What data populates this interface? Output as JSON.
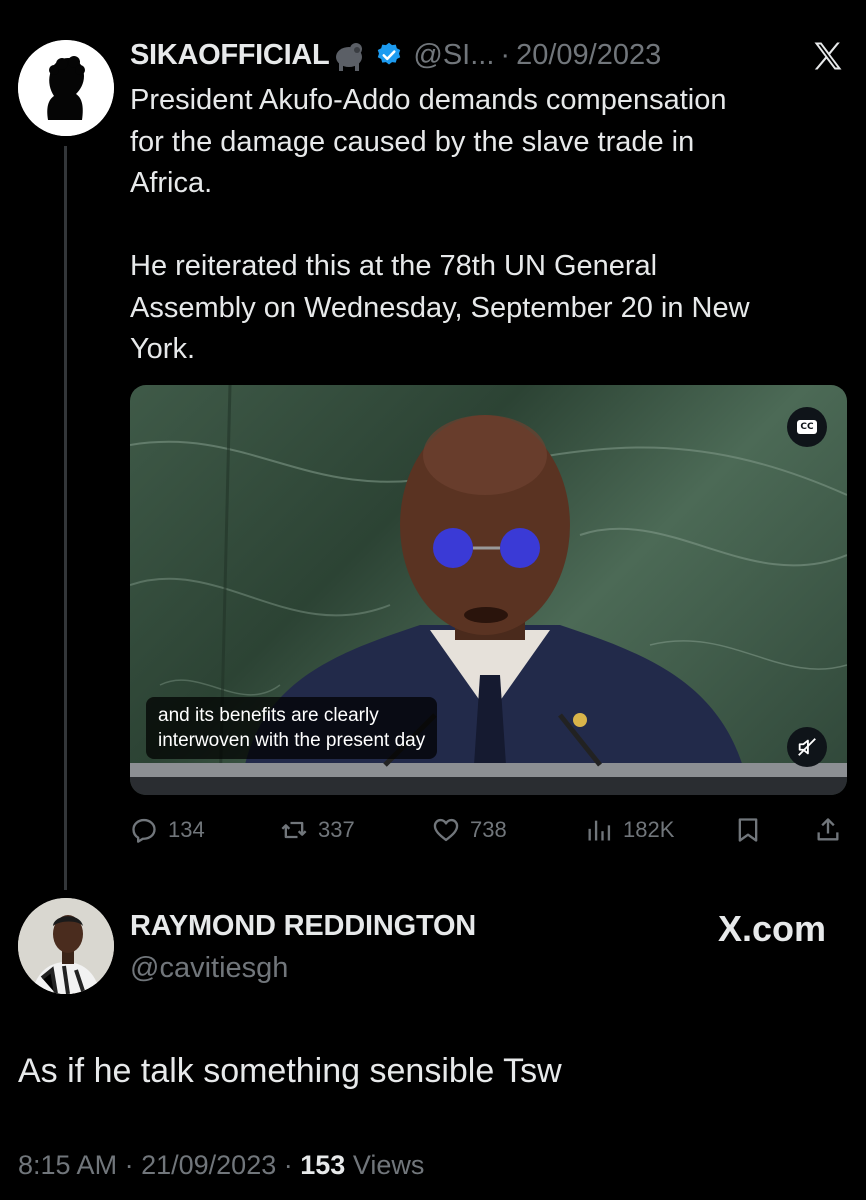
{
  "tweet": {
    "display_name": "SIKAOFFICIAL",
    "emoji": "gorilla",
    "handle": "@SI...",
    "separator": "·",
    "date": "20/09/2023",
    "text": "President Akufo-Addo demands compensation\nfor the damage caused by the slave trade in\nAfrica.\n\nHe reiterated this at the 78th UN General\nAssembly on Wednesday, September 20 in New\nYork.",
    "video": {
      "caption": "and its benefits are clearly\ninterwoven with the present day",
      "cc_label": "CC"
    },
    "actions": {
      "replies": "134",
      "reposts": "337",
      "likes": "738",
      "views": "182K"
    }
  },
  "reply": {
    "display_name": "RAYMOND REDDINGTON",
    "handle": "@cavitiesgh",
    "watermark": "X.com",
    "text": "As if he talk something sensible Tsw",
    "time": "8:15 AM",
    "separator": "·",
    "date": "21/09/2023",
    "views_count": "153",
    "views_label": "Views"
  },
  "colors": {
    "background": "#000000",
    "text": "#e7e9ea",
    "muted": "#71767b",
    "verified": "#1d9bf0"
  }
}
